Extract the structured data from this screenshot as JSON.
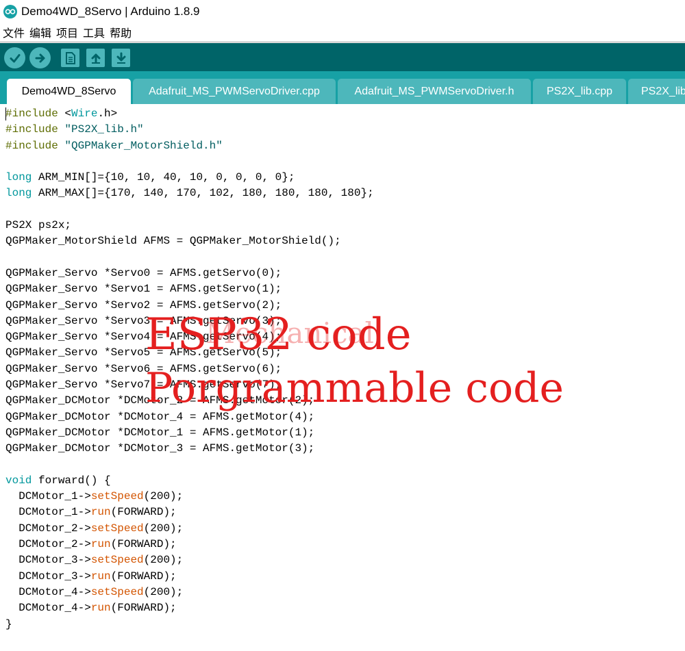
{
  "window": {
    "title": "Demo4WD_8Servo | Arduino 1.8.9"
  },
  "menu": {
    "items": [
      "文件",
      "编辑",
      "项目",
      "工具",
      "帮助"
    ]
  },
  "toolbar": {
    "icons": [
      "check-icon",
      "arrow-right-icon",
      "new-file-icon",
      "upload-arrow-icon",
      "download-arrow-icon"
    ]
  },
  "tabs": [
    "Demo4WD_8Servo",
    "Adafruit_MS_PWMServoDriver.cpp",
    "Adafruit_MS_PWMServoDriver.h",
    "PS2X_lib.cpp",
    "PS2X_lib"
  ],
  "code": {
    "lines": [
      [
        [
          "kw",
          "#include"
        ],
        [
          "",
          "  "
        ],
        [
          "",
          "<"
        ],
        [
          "ty",
          "Wire"
        ],
        [
          "",
          ".h>"
        ]
      ],
      [
        [
          "kw",
          "#include"
        ],
        [
          "",
          " "
        ],
        [
          "st",
          "\"PS2X_lib.h\""
        ]
      ],
      [
        [
          "kw",
          "#include"
        ],
        [
          "",
          " "
        ],
        [
          "st",
          "\"QGPMaker_MotorShield.h\""
        ]
      ],
      [],
      [
        [
          "ty",
          "long"
        ],
        [
          "",
          " ARM_MIN[]={10, 10, 40, 10, 0, 0, 0, 0};"
        ]
      ],
      [
        [
          "ty",
          "long"
        ],
        [
          "",
          " ARM_MAX[]={170, 140, 170, 102, 180, 180, 180, 180};"
        ]
      ],
      [],
      [
        [
          "",
          "PS2X ps2x;"
        ]
      ],
      [
        [
          "",
          "QGPMaker_MotorShield AFMS = QGPMaker_MotorShield();"
        ]
      ],
      [],
      [
        [
          "",
          "QGPMaker_Servo *Servo0 = AFMS.getServo(0);"
        ]
      ],
      [
        [
          "",
          "QGPMaker_Servo *Servo1 = AFMS.getServo(1);"
        ]
      ],
      [
        [
          "",
          "QGPMaker_Servo *Servo2 = AFMS.getServo(2);"
        ]
      ],
      [
        [
          "",
          "QGPMaker_Servo *Servo3 = AFMS.getServo(3);"
        ]
      ],
      [
        [
          "",
          "QGPMaker_Servo *Servo4 = AFMS.getServo(4);"
        ]
      ],
      [
        [
          "",
          "QGPMaker_Servo *Servo5 = AFMS.getServo(5);"
        ]
      ],
      [
        [
          "",
          "QGPMaker_Servo *Servo6 = AFMS.getServo(6);"
        ]
      ],
      [
        [
          "",
          "QGPMaker_Servo *Servo7 = AFMS.getServo(7);"
        ]
      ],
      [
        [
          "",
          "QGPMaker_DCMotor *DCMotor_2 = AFMS.getMotor(2);"
        ]
      ],
      [
        [
          "",
          "QGPMaker_DCMotor *DCMotor_4 = AFMS.getMotor(4);"
        ]
      ],
      [
        [
          "",
          "QGPMaker_DCMotor *DCMotor_1 = AFMS.getMotor(1);"
        ]
      ],
      [
        [
          "",
          "QGPMaker_DCMotor *DCMotor_3 = AFMS.getMotor(3);"
        ]
      ],
      [],
      [
        [
          "ty",
          "void"
        ],
        [
          "",
          " forward() {"
        ]
      ],
      [
        [
          "",
          "  DCMotor_1->"
        ],
        [
          "fn",
          "setSpeed"
        ],
        [
          "",
          "(200);"
        ]
      ],
      [
        [
          "",
          "  DCMotor_1->"
        ],
        [
          "fn",
          "run"
        ],
        [
          "",
          "(FORWARD);"
        ]
      ],
      [
        [
          "",
          "  DCMotor_2->"
        ],
        [
          "fn",
          "setSpeed"
        ],
        [
          "",
          "(200);"
        ]
      ],
      [
        [
          "",
          "  DCMotor_2->"
        ],
        [
          "fn",
          "run"
        ],
        [
          "",
          "(FORWARD);"
        ]
      ],
      [
        [
          "",
          "  DCMotor_3->"
        ],
        [
          "fn",
          "setSpeed"
        ],
        [
          "",
          "(200);"
        ]
      ],
      [
        [
          "",
          "  DCMotor_3->"
        ],
        [
          "fn",
          "run"
        ],
        [
          "",
          "(FORWARD);"
        ]
      ],
      [
        [
          "",
          "  DCMotor_4->"
        ],
        [
          "fn",
          "setSpeed"
        ],
        [
          "",
          "(200);"
        ]
      ],
      [
        [
          "",
          "  DCMotor_4->"
        ],
        [
          "fn",
          "run"
        ],
        [
          "",
          "(FORWARD);"
        ]
      ],
      [
        [
          "",
          "}"
        ]
      ]
    ]
  },
  "watermark": {
    "ghost": "Mechanical",
    "line1": "ESP32 code",
    "line2": "Porgrammable code"
  },
  "colors": {
    "toolbar": "#006468",
    "tabbar": "#17a1a5",
    "button": "#4db7bb",
    "keyword": "#5e6d03",
    "type": "#00979c",
    "string": "#005c5f",
    "function": "#d35400",
    "watermark": "#e41f1f"
  }
}
